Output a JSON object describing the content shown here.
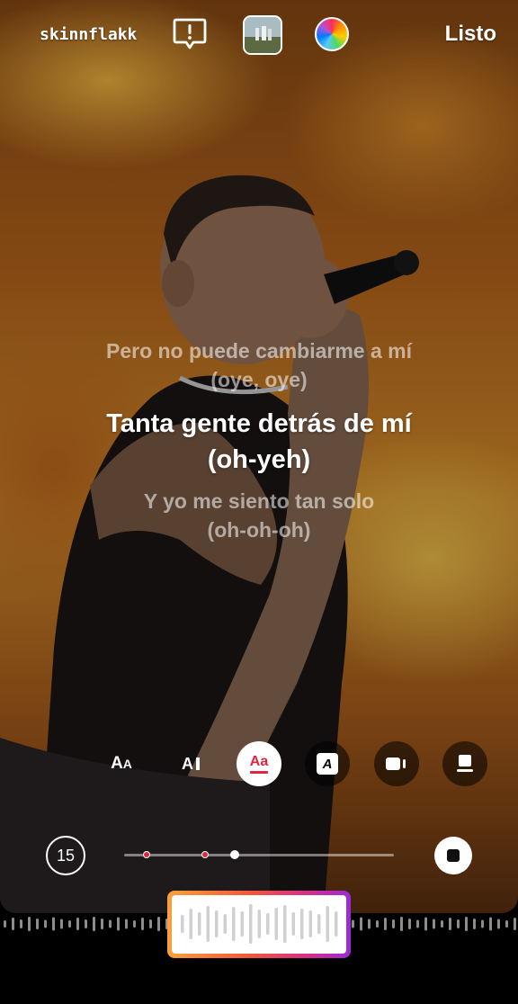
{
  "header": {
    "username": "skinnflakk",
    "done_label": "Listo",
    "alert_icon": "alert-bubble-icon",
    "cover_icon": "album-cover-thumbnail",
    "color_icon": "color-wheel-icon"
  },
  "lyrics": {
    "previous": [
      "Pero no puede cambiarme a mí",
      "(oye, oye)"
    ],
    "current": [
      "Tanta gente detrás de mí",
      "(oh-yeh)"
    ],
    "next": [
      "Y yo me siento tan solo",
      "(oh-oh-oh)"
    ]
  },
  "style_tools": [
    {
      "name": "text-size",
      "label": "Aᴀ"
    },
    {
      "name": "text-case",
      "label": "AI"
    },
    {
      "name": "lyrics-style",
      "label": "Aa"
    },
    {
      "name": "text-background",
      "label": "A"
    },
    {
      "name": "video-mode",
      "label": ""
    },
    {
      "name": "sticker-mode",
      "label": ""
    }
  ],
  "playback": {
    "duration_seconds": "15",
    "marker_positions": [
      0.083,
      0.3,
      0.41
    ],
    "progress": 0.41
  },
  "colors": {
    "accent_red": "#e0263d",
    "gradient_start": "#f7a23a",
    "gradient_end": "#9a2bd6"
  }
}
